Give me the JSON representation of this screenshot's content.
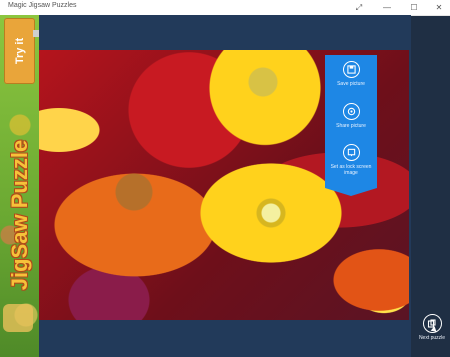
{
  "window": {
    "title": "Magic Jigsaw Puzzles",
    "controls": {
      "expand": "⤢",
      "minimize": "—",
      "maximize": "☐",
      "close": "✕"
    }
  },
  "ad": {
    "try_label": "Try it",
    "brand_text": "JigSaw Puzzle",
    "accent_color": "#8cc63f"
  },
  "actions": {
    "save": {
      "label": "Save picture",
      "icon": "save-icon"
    },
    "share": {
      "label": "Share picture",
      "icon": "share-icon"
    },
    "lock": {
      "label": "Set as lock screen image",
      "icon": "lock-screen-icon"
    }
  },
  "next": {
    "label": "Next puzzle",
    "icon": "next-puzzle-icon"
  },
  "colors": {
    "panel_blue": "#1e87e5",
    "background": "#223a5a"
  }
}
